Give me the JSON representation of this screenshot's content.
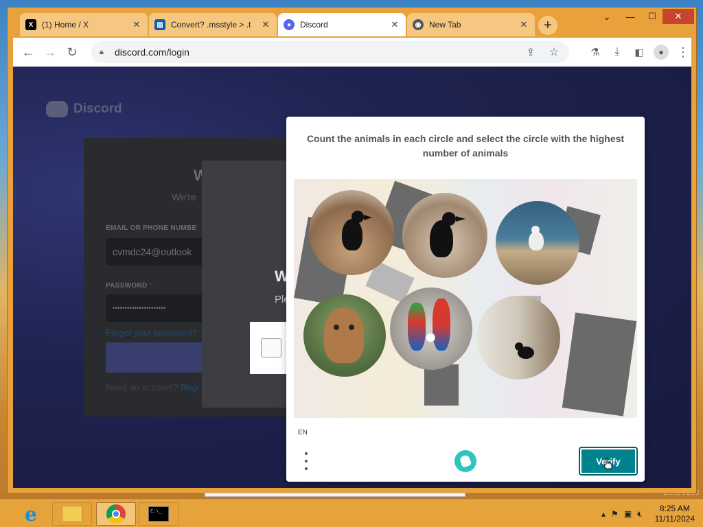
{
  "browser": {
    "tabs": [
      {
        "title": "(1) Home / X",
        "favicon": "x-logo-icon",
        "active": false
      },
      {
        "title": "Convert? .msstyle > .t",
        "favicon": "trello-icon",
        "active": false
      },
      {
        "title": "Discord",
        "favicon": "discord-icon",
        "active": true
      },
      {
        "title": "New Tab",
        "favicon": "chrome-icon",
        "active": false
      }
    ],
    "url": "discord.com/login",
    "window_controls": {
      "minimize": "—",
      "maximize": "☐",
      "close": "✕"
    },
    "accent_color": "#e9a23b"
  },
  "discord_page": {
    "logo_text": "Discord",
    "welcome": "W",
    "subtitle": "We're",
    "email_label": "EMAIL OR PHONE NUMBE",
    "email_value": "cvmdc24@outlook",
    "password_label": "PASSWORD",
    "password_required": "*",
    "password_value": "••••••••••••••••••••••",
    "forgot_password": "Forgot your password?",
    "need_account": "Need an account?",
    "register": "Regi",
    "overlay_title": "W",
    "overlay_sub": "Ple"
  },
  "captcha": {
    "prompt": "Count the animals in each circle and select the circle with the highest number of animals",
    "language": "EN",
    "verify_label": "Verify",
    "brand_color": "#00838f"
  },
  "taskbar": {
    "time": "8:25 AM",
    "date": "11/11/2024"
  },
  "desktop": {
    "watermark": "Build 9200"
  }
}
